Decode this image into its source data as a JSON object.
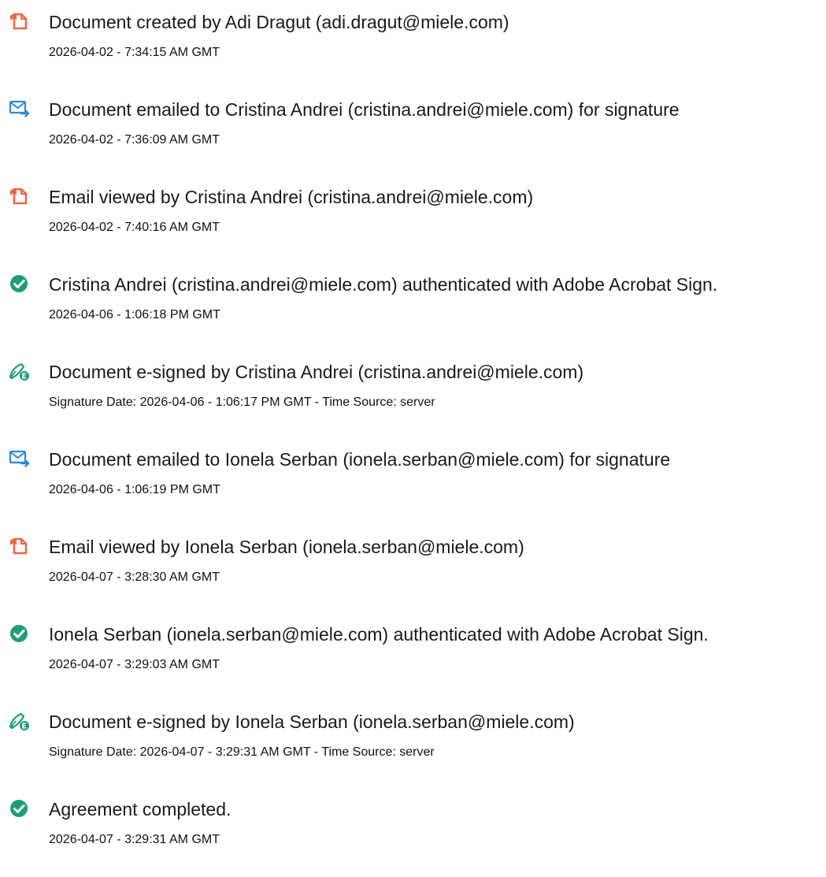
{
  "entries": [
    {
      "icon": "document-icon",
      "title": "Document created by Adi Dragut (adi.dragut@miele.com)",
      "subtitle": "2026-04-02 - 7:34:15 AM GMT"
    },
    {
      "icon": "email-icon",
      "title": "Document emailed to Cristina Andrei (cristina.andrei@miele.com) for signature",
      "subtitle": "2026-04-02 - 7:36:09 AM GMT"
    },
    {
      "icon": "document-icon",
      "title": "Email viewed by Cristina Andrei (cristina.andrei@miele.com)",
      "subtitle": "2026-04-02 - 7:40:16 AM GMT"
    },
    {
      "icon": "checkmark-icon",
      "title": "Cristina Andrei (cristina.andrei@miele.com) authenticated with Adobe Acrobat Sign.",
      "subtitle": "2026-04-06 - 1:06:18 PM GMT"
    },
    {
      "icon": "esign-pen-icon",
      "title": "Document e-signed by Cristina Andrei (cristina.andrei@miele.com)",
      "subtitle": "Signature Date: 2026-04-06 - 1:06:17 PM GMT - Time Source: server"
    },
    {
      "icon": "email-icon",
      "title": "Document emailed to Ionela Serban (ionela.serban@miele.com) for signature",
      "subtitle": "2026-04-06 - 1:06:19 PM GMT"
    },
    {
      "icon": "document-icon",
      "title": "Email viewed by Ionela Serban (ionela.serban@miele.com)",
      "subtitle": "2026-04-07 - 3:28:30 AM GMT"
    },
    {
      "icon": "checkmark-icon",
      "title": "Ionela Serban (ionela.serban@miele.com) authenticated with Adobe Acrobat Sign.",
      "subtitle": "2026-04-07 - 3:29:03 AM GMT"
    },
    {
      "icon": "esign-pen-icon",
      "title": "Document e-signed by Ionela Serban (ionela.serban@miele.com)",
      "subtitle": "Signature Date: 2026-04-07 - 3:29:31 AM GMT - Time Source: server"
    },
    {
      "icon": "checkmark-icon",
      "title": "Agreement completed.",
      "subtitle": "2026-04-07 - 3:29:31 AM GMT"
    }
  ],
  "colors": {
    "document": "#ec6845",
    "email": "#2a8bd8",
    "check": "#1f9e76",
    "text": "#1a1a1a"
  }
}
